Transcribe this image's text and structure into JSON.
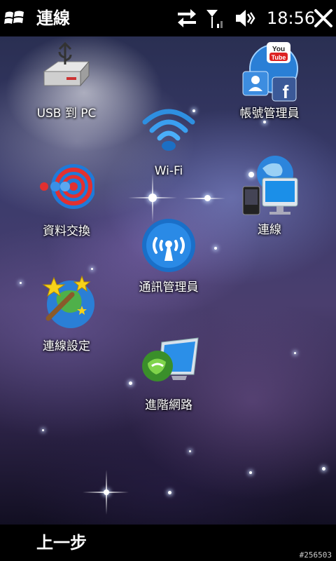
{
  "status_bar": {
    "title": "連線",
    "time": "18:56",
    "icons": [
      "windows-start-icon",
      "data-sync-arrows-icon",
      "signal-strength-icon",
      "speaker-muted-icon",
      "close-icon"
    ]
  },
  "apps": [
    {
      "label": "USB 到 PC",
      "icon": "usb-drive-icon"
    },
    {
      "label": "帳號管理員",
      "icon": "account-manager-icon"
    },
    {
      "label": "Wi-Fi",
      "icon": "wifi-icon"
    },
    {
      "label": "資料交換",
      "icon": "data-exchange-icon"
    },
    {
      "label": "連線",
      "icon": "connection-globe-icon"
    },
    {
      "label": "通訊管理員",
      "icon": "comm-manager-icon"
    },
    {
      "label": "連線設定",
      "icon": "connection-settings-icon"
    },
    {
      "label": "進階網路",
      "icon": "advanced-network-icon"
    }
  ],
  "menu_bar": {
    "left_softkey": "上一步"
  },
  "watermark": "#256503"
}
